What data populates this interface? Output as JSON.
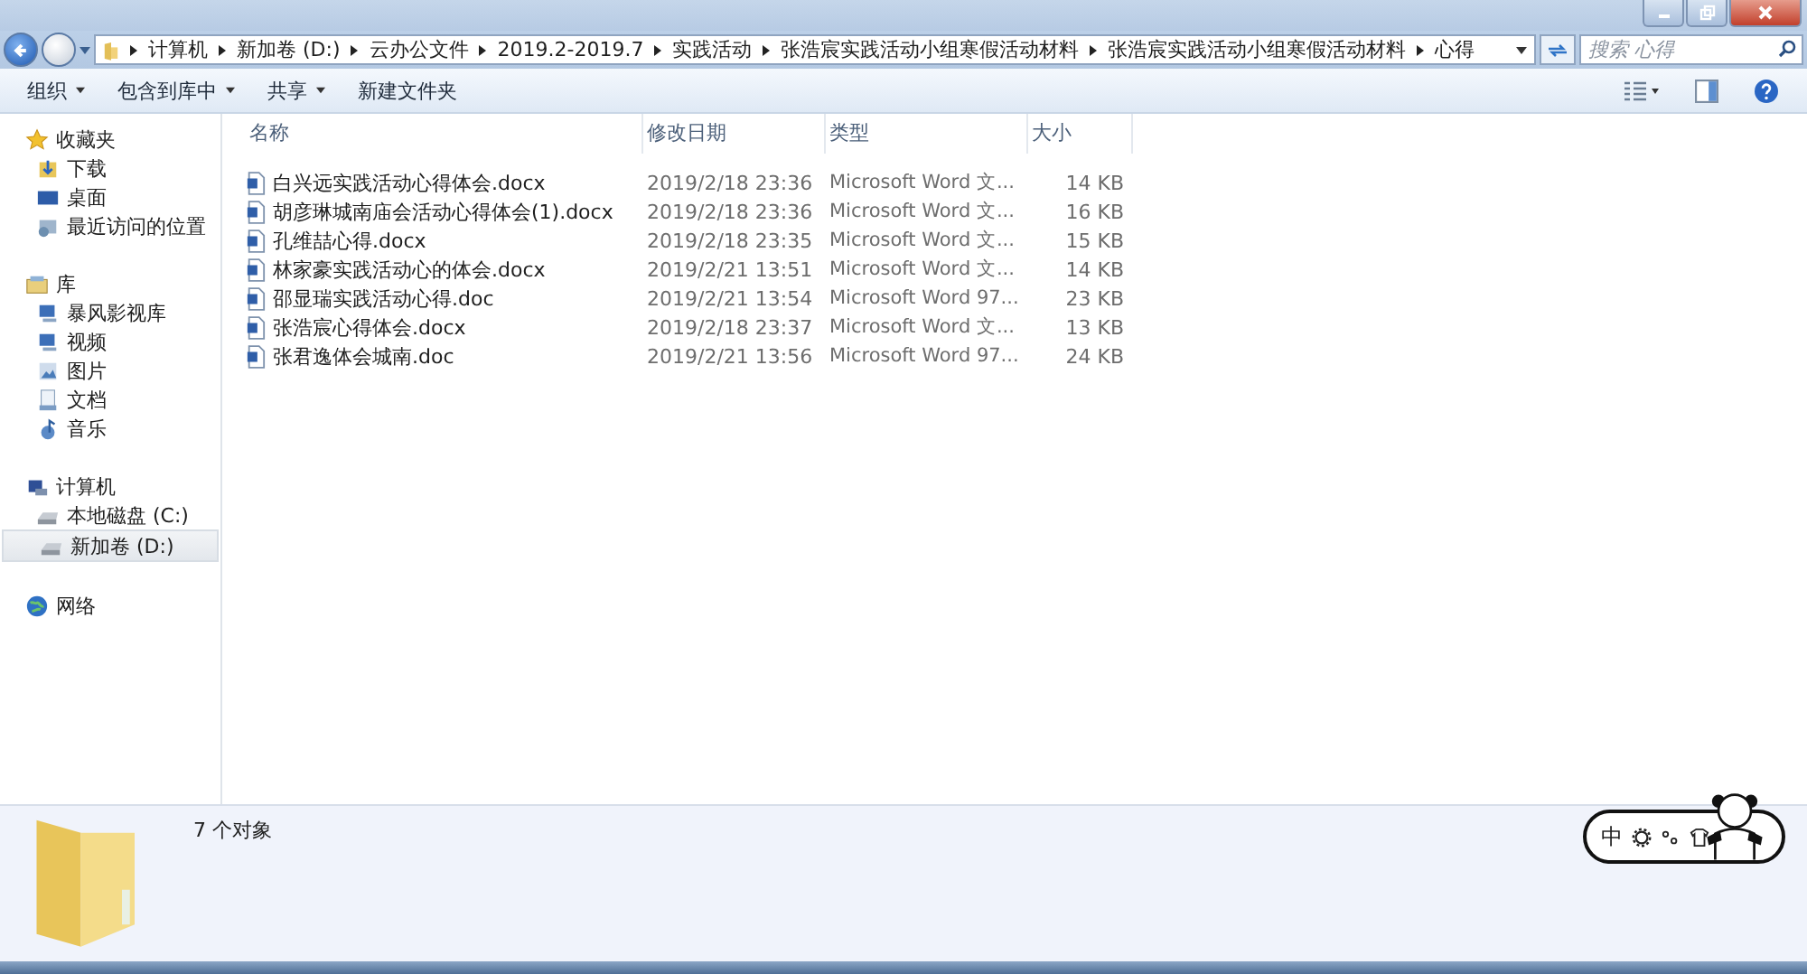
{
  "breadcrumbs": [
    "计算机",
    "新加卷 (D:)",
    "云办公文件",
    "2019.2-2019.7",
    "实践活动",
    "张浩宸实践活动小组寒假活动材料",
    "张浩宸实践活动小组寒假活动材料",
    "心得"
  ],
  "search": {
    "placeholder": "搜索 心得"
  },
  "toolbar": [
    {
      "label": "组织",
      "dropdown": true
    },
    {
      "label": "包含到库中",
      "dropdown": true
    },
    {
      "label": "共享",
      "dropdown": true
    },
    {
      "label": "新建文件夹",
      "dropdown": false
    }
  ],
  "sidebar": [
    {
      "label": "收藏夹",
      "kind": "favorites",
      "selected": false,
      "children": [
        {
          "label": "下载",
          "kind": "download",
          "selected": false
        },
        {
          "label": "桌面",
          "kind": "desktop",
          "selected": false
        },
        {
          "label": "最近访问的位置",
          "kind": "recent",
          "selected": false
        }
      ]
    },
    {
      "label": "库",
      "kind": "library",
      "selected": false,
      "children": [
        {
          "label": "暴风影视库",
          "kind": "media",
          "selected": false
        },
        {
          "label": "视频",
          "kind": "video",
          "selected": false
        },
        {
          "label": "图片",
          "kind": "pictures",
          "selected": false
        },
        {
          "label": "文档",
          "kind": "documents",
          "selected": false
        },
        {
          "label": "音乐",
          "kind": "music",
          "selected": false
        }
      ]
    },
    {
      "label": "计算机",
      "kind": "computer",
      "selected": false,
      "children": [
        {
          "label": "本地磁盘 (C:)",
          "kind": "drive",
          "selected": false
        },
        {
          "label": "新加卷 (D:)",
          "kind": "drive",
          "selected": true
        }
      ]
    },
    {
      "label": "网络",
      "kind": "network",
      "selected": false
    }
  ],
  "table": {
    "columns": [
      "名称",
      "修改日期",
      "类型",
      "大小"
    ],
    "rows": [
      {
        "name": "白兴远实践活动心得体会.docx",
        "date": "2019/2/18 23:36",
        "type": "Microsoft Word 文...",
        "size": "14 KB"
      },
      {
        "name": "胡彦琳城南庙会活动心得体会(1).docx",
        "date": "2019/2/18 23:36",
        "type": "Microsoft Word 文...",
        "size": "16 KB"
      },
      {
        "name": "孔维喆心得.docx",
        "date": "2019/2/18 23:35",
        "type": "Microsoft Word 文...",
        "size": "15 KB"
      },
      {
        "name": "林家豪实践活动心的体会.docx",
        "date": "2019/2/21 13:51",
        "type": "Microsoft Word 文...",
        "size": "14 KB"
      },
      {
        "name": "邵显瑞实践活动心得.doc",
        "date": "2019/2/21 13:54",
        "type": "Microsoft Word 97...",
        "size": "23 KB"
      },
      {
        "name": "张浩宸心得体会.docx",
        "date": "2019/2/18 23:37",
        "type": "Microsoft Word 文...",
        "size": "13 KB"
      },
      {
        "name": "张君逸体会城南.doc",
        "date": "2019/2/21 13:56",
        "type": "Microsoft Word 97...",
        "size": "24 KB"
      }
    ]
  },
  "status": {
    "count": "7 个对象"
  },
  "ime": {
    "mode": "中"
  }
}
